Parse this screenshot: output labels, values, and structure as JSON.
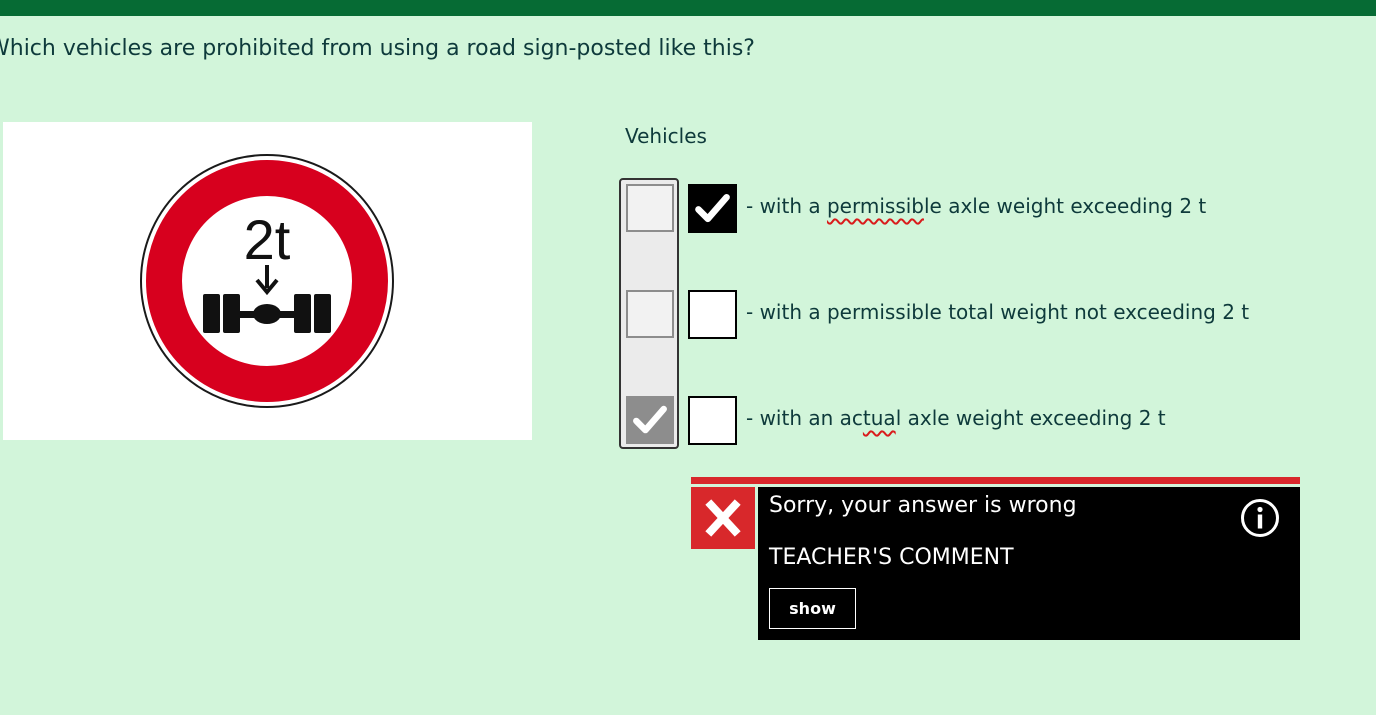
{
  "question": "Which vehicles are prohibited from using a road sign-posted like this?",
  "sign": {
    "weight_text": "2t",
    "ring_color": "#d7001e",
    "icon": "axle-weight-limit-sign"
  },
  "vehicles_label": "Vehicles",
  "options": [
    {
      "pre": "- with a ",
      "mark": "permissib",
      "post": "le axle weight exceeding 2 t",
      "user_checked": true,
      "correct_checked": false
    },
    {
      "text": "- with a permissible total weight not exceeding 2 t",
      "user_checked": false,
      "correct_checked": false
    },
    {
      "pre": "- with an ac",
      "mark": "tua",
      "post": "l axle weight exceeding 2 t",
      "user_checked": false,
      "correct_checked": true
    }
  ],
  "feedback": {
    "title": "Sorry, your answer is wrong",
    "comment_heading": "TEACHER'S COMMENT",
    "show_label": "show",
    "error_color": "#d8282b",
    "icons": [
      "close-x-icon",
      "info-icon"
    ]
  },
  "colors": {
    "top_bar": "#066b34",
    "background": "#d2f5da",
    "text": "#0e3a3b"
  }
}
